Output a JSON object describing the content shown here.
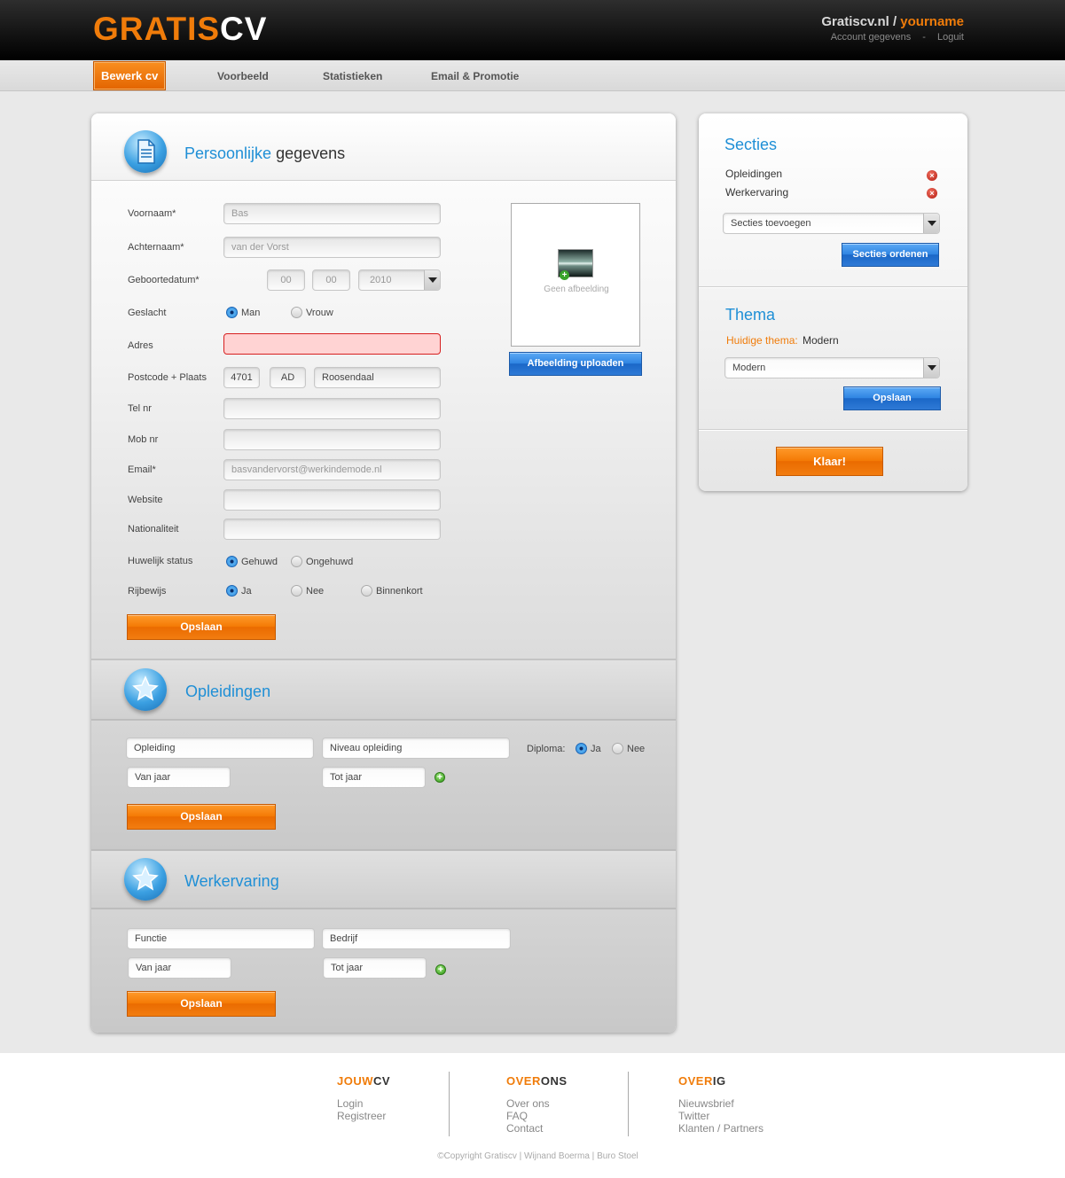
{
  "header": {
    "logo_part1": "GRATIS",
    "logo_part2": "CV",
    "site": "Gratiscv.nl",
    "separator": "/",
    "username": "yourname",
    "account_link": "Account gegevens",
    "link_sep": "-",
    "logout_link": "Loguit"
  },
  "nav": {
    "items": [
      {
        "label": "Bewerk cv"
      },
      {
        "label": "Voorbeeld"
      },
      {
        "label": "Statistieken"
      },
      {
        "label": "Email & Promotie"
      }
    ]
  },
  "personal": {
    "title_highlight": "Persoonlijke",
    "title_rest": "gegevens",
    "fields": {
      "voornaam": {
        "label": "Voornaam*",
        "value": "Bas"
      },
      "achternaam": {
        "label": "Achternaam*",
        "value": "van der Vorst"
      },
      "geboortedatum": {
        "label": "Geboortedatum*",
        "day": "00",
        "month": "00",
        "year": "2010"
      },
      "geslacht": {
        "label": "Geslacht",
        "options": [
          "Man",
          "Vrouw"
        ],
        "selected": "Man"
      },
      "adres": {
        "label": "Adres",
        "value": ""
      },
      "postcode": {
        "label": "Postcode + Plaats",
        "digits": "4701",
        "letters": "AD",
        "city": "Roosendaal"
      },
      "tel": {
        "label": "Tel nr",
        "value": ""
      },
      "mob": {
        "label": "Mob nr",
        "value": ""
      },
      "email": {
        "label": "Email*",
        "value": "basvandervorst@werkindemode.nl"
      },
      "website": {
        "label": "Website",
        "value": ""
      },
      "nationaliteit": {
        "label": "Nationaliteit",
        "value": ""
      },
      "huwelijk": {
        "label": "Huwelijk status",
        "options": [
          "Gehuwd",
          "Ongehuwd"
        ],
        "selected": "Gehuwd"
      },
      "rijbewijs": {
        "label": "Rijbewijs",
        "options": [
          "Ja",
          "Nee",
          "Binnenkort"
        ],
        "selected": "Ja"
      }
    },
    "photo_placeholder": "Geen afbeelding",
    "upload_button": "Afbeelding uploaden",
    "save_button": "Opslaan"
  },
  "opleidingen": {
    "title": "Opleidingen",
    "opleiding_placeholder": "Opleiding",
    "niveau_placeholder": "Niveau opleiding",
    "diploma_label": "Diploma:",
    "diploma_options": [
      "Ja",
      "Nee"
    ],
    "diploma_selected": "Ja",
    "van_placeholder": "Van jaar",
    "tot_placeholder": "Tot jaar",
    "save_button": "Opslaan"
  },
  "werkervaring": {
    "title": "Werkervaring",
    "functie_placeholder": "Functie",
    "bedrijf_placeholder": "Bedrijf",
    "van_placeholder": "Van jaar",
    "tot_placeholder": "Tot jaar",
    "save_button": "Opslaan"
  },
  "sidebar": {
    "secties_title": "Secties",
    "sections": [
      {
        "label": "Opleidingen"
      },
      {
        "label": "Werkervaring"
      }
    ],
    "add_select": "Secties toevoegen",
    "order_button": "Secties ordenen",
    "thema_title": "Thema",
    "current_theme_label": "Huidige thema:",
    "current_theme_value": "Modern",
    "theme_select": "Modern",
    "theme_save_button": "Opslaan",
    "done_button": "Klaar!"
  },
  "footer": {
    "col1": {
      "head_orange": "JOUW",
      "head_dark": "CV",
      "links": [
        "Login",
        "Registreer"
      ]
    },
    "col2": {
      "head_orange": "OVER",
      "head_dark": "ONS",
      "links": [
        "Over ons",
        "FAQ",
        "Contact"
      ]
    },
    "col3": {
      "head_orange": "OVER",
      "head_dark": "IG",
      "links": [
        "Nieuwsbrief",
        "Twitter",
        "Klanten / Partners"
      ]
    },
    "copyright": "©Copyright Gratiscv | Wijnand Boerma | Buro Stoel"
  },
  "colors": {
    "accent_orange": "#f07c0a",
    "accent_blue": "#1f8fd6",
    "error_red": "#d72020"
  }
}
